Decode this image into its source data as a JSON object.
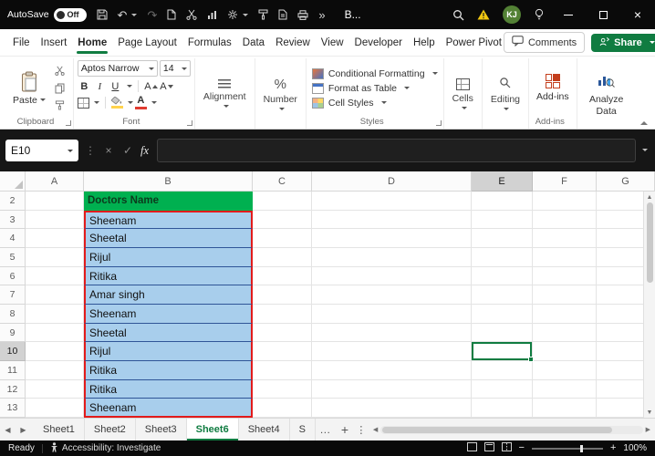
{
  "colors": {
    "accent_green": "#107C41",
    "header_fill": "#00B050",
    "data_fill": "#A8CEEC",
    "data_cell_border": "#2F5597",
    "range_border": "#E21B1B",
    "warning_yellow": "#F2C811",
    "titlebar_bg": "#0A0A0A"
  },
  "titlebar": {
    "autosave_label": "AutoSave",
    "autosave_state": "Off",
    "doc_title": "B...",
    "avatar_initials": "KJ"
  },
  "menubar": {
    "items": [
      "File",
      "Insert",
      "Home",
      "Page Layout",
      "Formulas",
      "Data",
      "Review",
      "View",
      "Developer",
      "Help",
      "Power Pivot"
    ],
    "active": "Home",
    "comments_label": "Comments",
    "share_label": "Share"
  },
  "ribbon": {
    "paste": "Paste",
    "bold": "B",
    "italic": "I",
    "underline": "U",
    "font_name": "Aptos Narrow",
    "font_size": "14",
    "percent": "%",
    "alignment": "Alignment",
    "number": "Number",
    "conditional_formatting": "Conditional Formatting",
    "format_as_table": "Format as Table",
    "cell_styles": "Cell Styles",
    "cells": "Cells",
    "editing": "Editing",
    "addins_button": "Add-ins",
    "analyze_data": "Analyze Data",
    "groups": {
      "clipboard": "Clipboard",
      "font": "Font",
      "styles": "Styles",
      "addins": "Add-ins"
    }
  },
  "formula_bar": {
    "name_box": "E10",
    "fx": "fx",
    "formula": ""
  },
  "grid": {
    "columns": [
      "A",
      "B",
      "C",
      "D",
      "E",
      "F",
      "G"
    ],
    "rows": [
      2,
      3,
      4,
      5,
      6,
      7,
      8,
      9,
      10,
      11,
      12,
      13
    ],
    "header_cell": {
      "row": 2,
      "column": "B",
      "text": "Doctors Name"
    },
    "data_column": "B",
    "data_start_row": 3,
    "names": [
      "Sheenam",
      "Sheetal",
      "Rijul",
      "Ritika",
      "Amar singh",
      "Sheenam",
      "Sheetal",
      "Rijul",
      "Ritika",
      "Ritika",
      "Sheenam"
    ],
    "selected": {
      "cell": "E10",
      "column": "E",
      "row": 10
    }
  },
  "sheet_tabs": {
    "tabs": [
      "Sheet1",
      "Sheet2",
      "Sheet3",
      "Sheet6",
      "Sheet4",
      "S"
    ],
    "active": "Sheet6",
    "more": "…",
    "add": "+"
  },
  "status_bar": {
    "ready": "Ready",
    "accessibility": "Accessibility: Investigate",
    "zoom": "100%"
  }
}
